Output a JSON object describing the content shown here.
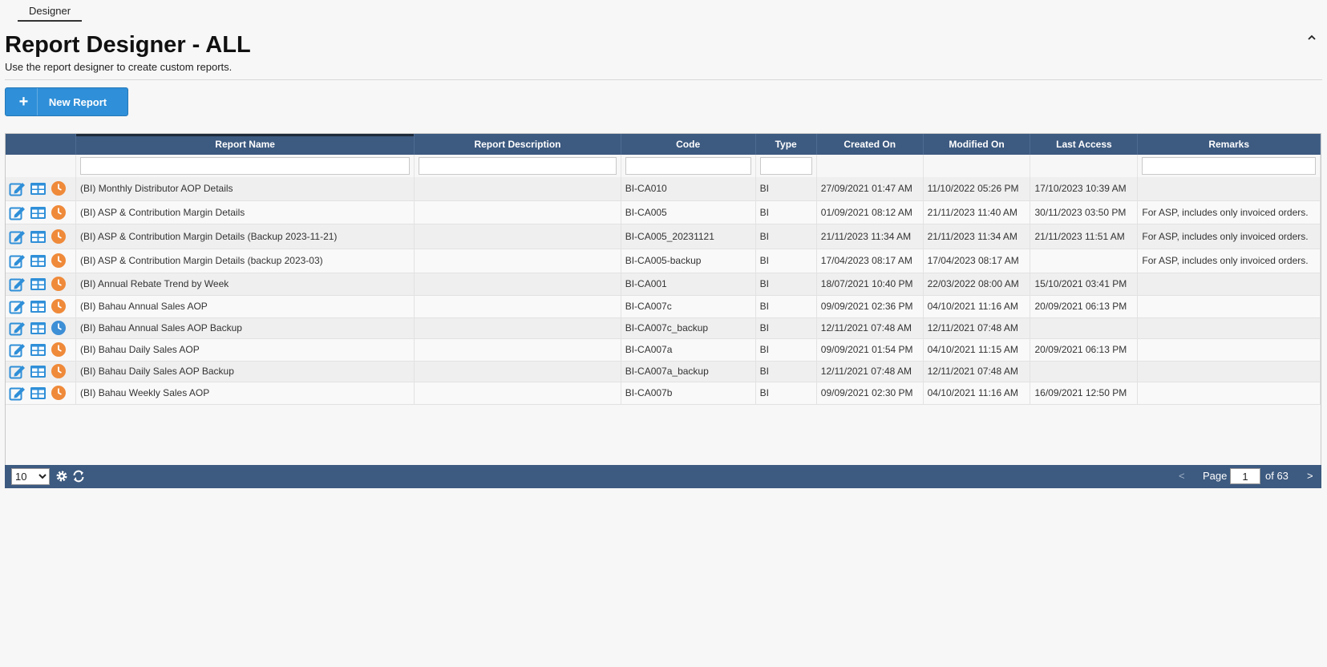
{
  "tabs": {
    "designer": "Designer"
  },
  "header": {
    "title": "Report Designer - ALL",
    "subtitle": "Use the report designer to create custom reports."
  },
  "toolbar": {
    "new_report_icon": "+",
    "new_report_label": "New Report"
  },
  "colors": {
    "header_bg": "#3d5a80",
    "button_bg": "#2f8fd8",
    "edit_icon": "#2f8fd8",
    "clock_orange": "#ef8a3a",
    "clock_blue": "#3d8fd6"
  },
  "table": {
    "columns": [
      "",
      "Report Name",
      "Report Description",
      "Code",
      "Type",
      "Created On",
      "Modified On",
      "Last Access",
      "Remarks"
    ],
    "rows": [
      {
        "name": "(BI) Monthly Distributor AOP Details",
        "description": "",
        "code": "BI-CA010",
        "type": "BI",
        "created": "27/09/2021 01:47 AM",
        "modified": "11/10/2022 05:26 PM",
        "last_access": "17/10/2023 10:39 AM",
        "remarks": "",
        "schedule_icon": "clock-orange"
      },
      {
        "name": "(BI) ASP & Contribution Margin Details",
        "description": "",
        "code": "BI-CA005",
        "type": "BI",
        "created": "01/09/2021 08:12 AM",
        "modified": "21/11/2023 11:40 AM",
        "last_access": "30/11/2023 03:50 PM",
        "remarks": "For ASP, includes only invoiced orders.",
        "schedule_icon": "clock-orange"
      },
      {
        "name": "(BI) ASP & Contribution Margin Details (Backup 2023-11-21)",
        "description": "",
        "code": "BI-CA005_20231121",
        "type": "BI",
        "created": "21/11/2023 11:34 AM",
        "modified": "21/11/2023 11:34 AM",
        "last_access": "21/11/2023 11:51 AM",
        "remarks": "For ASP, includes only invoiced orders.",
        "schedule_icon": "clock-orange"
      },
      {
        "name": "(BI) ASP & Contribution Margin Details (backup 2023-03)",
        "description": "",
        "code": "BI-CA005-backup",
        "type": "BI",
        "created": "17/04/2023 08:17 AM",
        "modified": "17/04/2023 08:17 AM",
        "last_access": "",
        "remarks": "For ASP, includes only invoiced orders.",
        "schedule_icon": "clock-orange"
      },
      {
        "name": "(BI) Annual Rebate Trend by Week",
        "description": "",
        "code": "BI-CA001",
        "type": "BI",
        "created": "18/07/2021 10:40 PM",
        "modified": "22/03/2022 08:00 AM",
        "last_access": "15/10/2021 03:41 PM",
        "remarks": "",
        "schedule_icon": "clock-orange"
      },
      {
        "name": "(BI) Bahau Annual Sales AOP",
        "description": "",
        "code": "BI-CA007c",
        "type": "BI",
        "created": "09/09/2021 02:36 PM",
        "modified": "04/10/2021 11:16 AM",
        "last_access": "20/09/2021 06:13 PM",
        "remarks": "",
        "schedule_icon": "clock-orange"
      },
      {
        "name": "(BI) Bahau Annual Sales AOP Backup",
        "description": "",
        "code": "BI-CA007c_backup",
        "type": "BI",
        "created": "12/11/2021 07:48 AM",
        "modified": "12/11/2021 07:48 AM",
        "last_access": "",
        "remarks": "",
        "schedule_icon": "clock-blue"
      },
      {
        "name": "(BI) Bahau Daily Sales AOP",
        "description": "",
        "code": "BI-CA007a",
        "type": "BI",
        "created": "09/09/2021 01:54 PM",
        "modified": "04/10/2021 11:15 AM",
        "last_access": "20/09/2021 06:13 PM",
        "remarks": "",
        "schedule_icon": "clock-orange"
      },
      {
        "name": "(BI) Bahau Daily Sales AOP Backup",
        "description": "",
        "code": "BI-CA007a_backup",
        "type": "BI",
        "created": "12/11/2021 07:48 AM",
        "modified": "12/11/2021 07:48 AM",
        "last_access": "",
        "remarks": "",
        "schedule_icon": "clock-orange"
      },
      {
        "name": "(BI) Bahau Weekly Sales AOP",
        "description": "",
        "code": "BI-CA007b",
        "type": "BI",
        "created": "09/09/2021 02:30 PM",
        "modified": "04/10/2021 11:16 AM",
        "last_access": "16/09/2021 12:50 PM",
        "remarks": "",
        "schedule_icon": "clock-orange"
      }
    ]
  },
  "pager": {
    "page_size": "10",
    "page_size_options": [
      "10"
    ],
    "prev": "<",
    "page_label": "Page",
    "current_page": "1",
    "of_label": "of 63",
    "next": ">"
  }
}
